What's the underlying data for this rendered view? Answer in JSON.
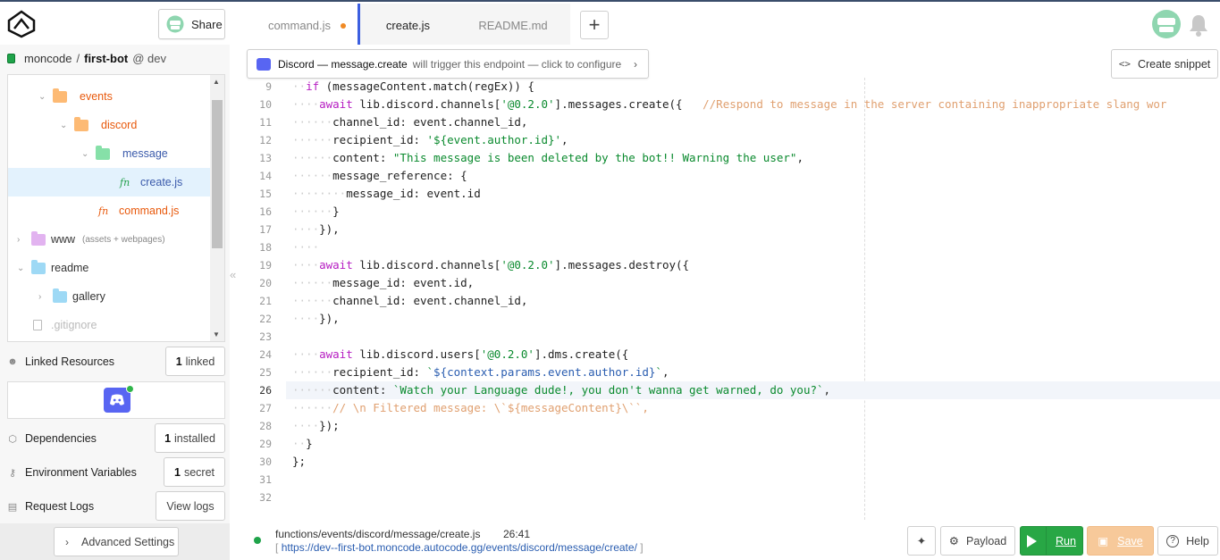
{
  "header": {
    "share_label": "Share",
    "tabs": [
      {
        "label": "command.js",
        "modified": true
      },
      {
        "label": "create.js",
        "active": true
      },
      {
        "label": "README.md"
      }
    ],
    "new_tab_symbol": "+"
  },
  "sidebar": {
    "project": {
      "owner": "moncode",
      "sep": "/",
      "name": "first-bot",
      "env": "@ dev"
    },
    "tree": {
      "events": "events",
      "discord": "discord",
      "message": "message",
      "create": "create.js",
      "command": "command.js",
      "www": "www",
      "www_note": "(assets + webpages)",
      "readme": "readme",
      "gallery": "gallery",
      "gitignore": ".gitignore",
      "fn_symbol": "fn"
    },
    "linked": {
      "label": "Linked Resources",
      "count": "1",
      "suffix": "linked"
    },
    "dependencies": {
      "label": "Dependencies",
      "count": "1",
      "suffix": "installed"
    },
    "env": {
      "label": "Environment Variables",
      "count": "1",
      "suffix": "secret"
    },
    "logs": {
      "label": "Request Logs",
      "button": "View logs"
    },
    "advanced": "Advanced Settings"
  },
  "endpoint": {
    "service": "Discord — message.create",
    "text": "will trigger this endpoint — click to configure"
  },
  "snippet_label": "Create snippet",
  "code": {
    "line_numbers": [
      "9",
      "10",
      "11",
      "12",
      "13",
      "14",
      "15",
      "16",
      "17",
      "18",
      "19",
      "20",
      "21",
      "22",
      "23",
      "24",
      "25",
      "26",
      "27",
      "28",
      "29",
      "30",
      "31",
      "32"
    ]
  },
  "footer": {
    "path": "functions/events/discord/message/create.js",
    "position": "26:41",
    "url_open": "[",
    "url": "https://dev--first-bot.moncode.autocode.gg/events/discord/message/create/",
    "url_close": "]",
    "payload": "Payload",
    "run": "Run",
    "save": "Save",
    "help": "Help"
  },
  "colors": {
    "accent": "#3c5fe0",
    "run": "#28a745",
    "save": "#f7c99a",
    "discord": "#5865f2",
    "modified_dot": "#f08a24"
  }
}
